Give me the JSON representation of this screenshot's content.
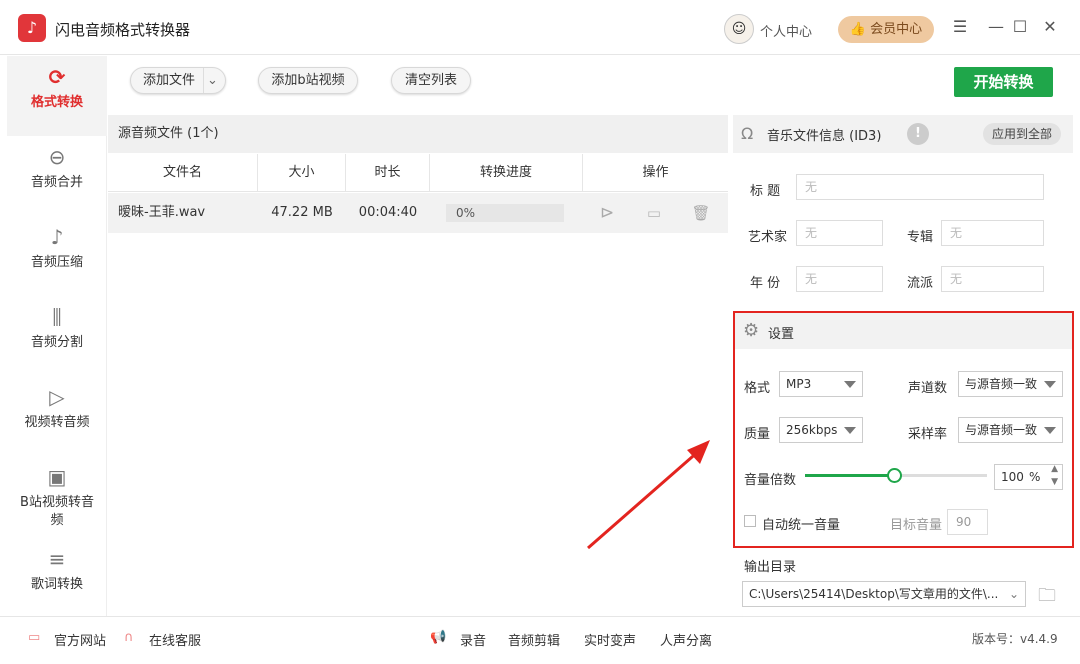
{
  "app": {
    "title": "闪电音频格式转换器",
    "logo_glyph": "♪"
  },
  "titlebar": {
    "personal_center": "个人中心",
    "vip_center": "会员中心",
    "menu_glyph": "☰",
    "min_glyph": "—",
    "max_glyph": "☐",
    "close_glyph": "✕"
  },
  "sidebar": {
    "items": [
      {
        "label": "格式转换",
        "icon": "refresh-icon",
        "glyph": "⟳"
      },
      {
        "label": "音频合并",
        "icon": "merge-icon",
        "glyph": "⊖"
      },
      {
        "label": "音频压缩",
        "icon": "compress-icon",
        "glyph": "♪"
      },
      {
        "label": "音频分割",
        "icon": "split-icon",
        "glyph": "⫼"
      },
      {
        "label": "视频转音频",
        "icon": "video-audio-icon",
        "glyph": "▷"
      },
      {
        "label": "B站视频转音",
        "label2": "频",
        "icon": "bilibili-icon",
        "glyph": "▣"
      },
      {
        "label": "歌词转换",
        "icon": "lyrics-icon",
        "glyph": "≡"
      }
    ]
  },
  "toolbar": {
    "add_file": "添加文件",
    "add_bilibili": "添加b站视频",
    "clear_list": "清空列表",
    "start": "开始转换"
  },
  "files": {
    "header": "源音频文件 (1个)",
    "columns": [
      "文件名",
      "大小",
      "时长",
      "转换进度",
      "操作"
    ],
    "rows": [
      {
        "name": "暧昧-王菲.wav",
        "size": "47.22 MB",
        "duration": "00:04:40",
        "progress": "0%"
      }
    ]
  },
  "id3": {
    "title": "音乐文件信息 (ID3)",
    "apply_all": "应用到全部",
    "fields": {
      "title_label": "标 题",
      "artist_label": "艺术家",
      "album_label": "专辑",
      "year_label": "年 份",
      "genre_label": "流派",
      "placeholder": "无"
    }
  },
  "settings": {
    "title": "设置",
    "format_label": "格式",
    "format_value": "MP3",
    "channels_label": "声道数",
    "channels_value": "与源音频一致",
    "quality_label": "质量",
    "quality_value": "256kbps",
    "samplerate_label": "采样率",
    "samplerate_value": "与源音频一致",
    "volume_label": "音量倍数",
    "volume_value": "100",
    "volume_unit": "%",
    "volume_fraction": 0.5,
    "auto_volume_label": "自动统一音量",
    "target_volume_label": "目标音量",
    "target_volume_value": "90"
  },
  "output": {
    "label": "输出目录",
    "path": "C:\\Users\\25414\\Desktop\\写文章用的文件\\..."
  },
  "footer": {
    "website": "官方网站",
    "service": "在线客服",
    "record": "录音",
    "edit": "音频剪辑",
    "voice_change": "实时变声",
    "vocal_split": "人声分离",
    "version": "版本号：v4.4.9"
  },
  "colors": {
    "accent_red": "#e02e2e",
    "start_green": "#1fa64a",
    "vip_gold": "#efc9a0",
    "highlight_red": "#e3241f"
  }
}
